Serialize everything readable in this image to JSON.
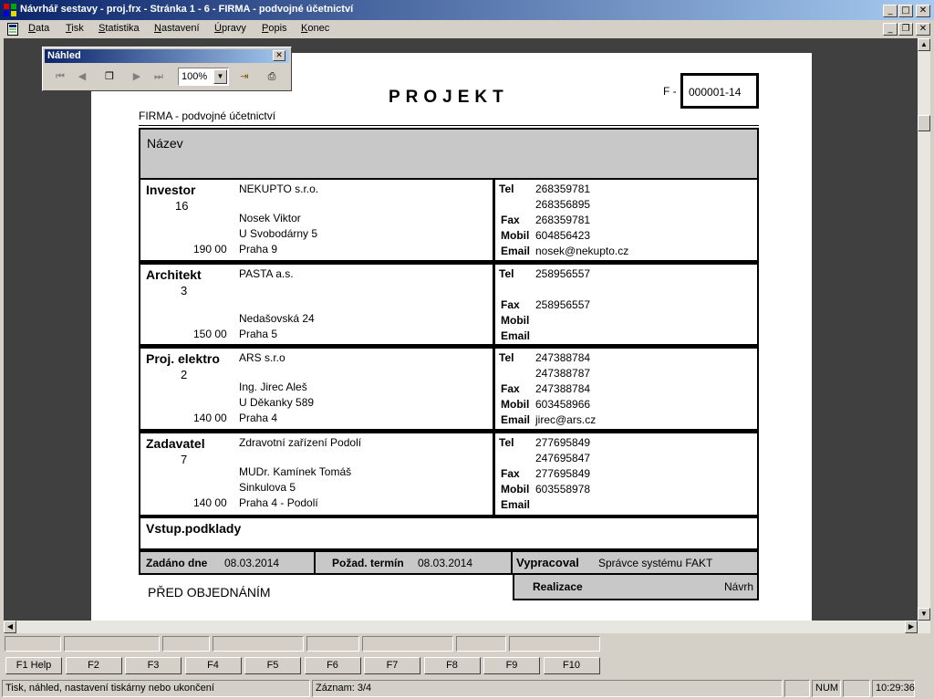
{
  "window": {
    "title": "Návrhář sestavy - proj.frx - Stránka 1 - 6 - FIRMA - podvojné účetnictví"
  },
  "menu": [
    "Data",
    "Tisk",
    "Statistika",
    "Nastavení",
    "Úpravy",
    "Popis",
    "Konec"
  ],
  "preview_toolbar": {
    "title": "Náhled",
    "zoom": "100%"
  },
  "report": {
    "title": "PROJEKT",
    "number_prefix": "F -",
    "number": "000001-14",
    "company": "FIRMA - podvojné účetnictví",
    "name_label": "Název",
    "contact_labels": {
      "tel": "Tel",
      "fax": "Fax",
      "mobil": "Mobil",
      "email": "Email"
    },
    "parties": [
      {
        "role": "Investor",
        "code": "16",
        "name": "NEKUPTO s.r.o.",
        "person": "Nosek Viktor",
        "street": "U Svobodárny 5",
        "zip": "190 00",
        "city": "Praha 9",
        "tel": "268359781",
        "tel2": "268356895",
        "fax": "268359781",
        "mobil": "604856423",
        "email": "nosek@nekupto.cz"
      },
      {
        "role": "Architekt",
        "code": "3",
        "name": "PASTA a.s.",
        "person": "",
        "street": "Nedašovská 24",
        "zip": "150 00",
        "city": "Praha 5",
        "tel": "258956557",
        "tel2": "",
        "fax": "258956557",
        "mobil": "",
        "email": ""
      },
      {
        "role": "Proj. elektro",
        "code": "2",
        "name": "ARS s.r.o",
        "person": "Ing. Jirec Aleš",
        "street": "U Děkanky 589",
        "zip": "140 00",
        "city": "Praha 4",
        "tel": "247388784",
        "tel2": "247388787",
        "fax": "247388784",
        "mobil": "603458966",
        "email": "jirec@ars.cz"
      },
      {
        "role": "Zadavatel",
        "code": "7",
        "name": "Zdravotní zařízení Podolí",
        "person": "MUDr. Kamínek Tomáš",
        "street": "Sinkulova 5",
        "zip": "140 00",
        "city": "Praha 4 - Podolí",
        "tel": "277695849",
        "tel2": "247695847",
        "fax": "277695849",
        "mobil": "603558978",
        "email": ""
      }
    ],
    "inputs_label": "Vstup.podklady",
    "zadano_label": "Zadáno dne",
    "zadano": "08.03.2014",
    "termin_label": "Požad. termín",
    "termin": "08.03.2014",
    "vypracoval_label": "Vypracoval",
    "vypracoval": "Správce systému FAKT",
    "realizace_label": "Realizace",
    "realizace": "Návrh",
    "status": "PŘED OBJEDNÁNÍM"
  },
  "function_keys": [
    "F1 Help",
    "F2",
    "F3",
    "F4",
    "F5",
    "F6",
    "F7",
    "F8",
    "F9",
    "F10"
  ],
  "statusbar": {
    "hint": "Tisk, náhled, nastavení tiskárny nebo ukončení",
    "record": "Záznam: 3/4",
    "num": "NUM",
    "time": "10:29:36"
  }
}
